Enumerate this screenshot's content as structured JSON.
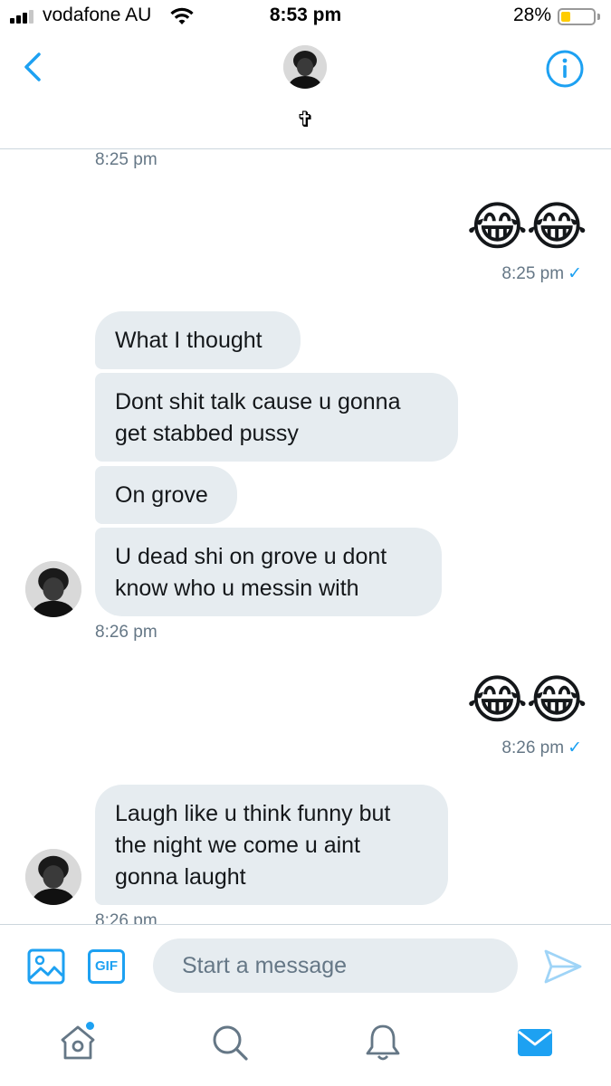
{
  "status_bar": {
    "carrier": "vodafone AU",
    "time": "8:53 pm",
    "battery_percent": "28%",
    "battery_level": 0.28,
    "signal_bars": 3
  },
  "header": {
    "contact_name": "✞",
    "back_icon": "chevron-left-icon",
    "info_icon": "info-icon"
  },
  "messages": [
    {
      "type": "timestamp",
      "side": "received",
      "text": "8:25 pm"
    },
    {
      "type": "emoji",
      "side": "sent",
      "text": "😂😂"
    },
    {
      "type": "timestamp",
      "side": "sent",
      "text": "8:25 pm",
      "read_receipt": "✓"
    },
    {
      "type": "bubble",
      "side": "received",
      "lines": [
        "What I thought"
      ]
    },
    {
      "type": "bubble",
      "side": "received",
      "lines": [
        "Dont shit talk cause u gonna",
        "get stabbed pussy"
      ]
    },
    {
      "type": "bubble",
      "side": "received",
      "lines": [
        "On grove"
      ]
    },
    {
      "type": "bubble",
      "side": "received",
      "lines": [
        "U dead shi on grove u dont",
        "know who u messin with"
      ]
    },
    {
      "type": "timestamp",
      "side": "received",
      "text": "8:26 pm"
    },
    {
      "type": "emoji",
      "side": "sent",
      "text": "😂😂"
    },
    {
      "type": "timestamp",
      "side": "sent",
      "text": "8:26 pm",
      "read_receipt": "✓"
    },
    {
      "type": "bubble",
      "side": "received",
      "lines": [
        "Laugh like u think funny but",
        "the night we come u aint",
        "gonna laught"
      ]
    },
    {
      "type": "timestamp",
      "side": "received",
      "text": "8:26 pm"
    }
  ],
  "composer": {
    "placeholder": "Start a message",
    "gif_label": "GIF",
    "media_icon": "image-icon",
    "send_icon": "send-icon"
  },
  "tab_bar": {
    "items": [
      "home-icon",
      "search-icon",
      "bell-icon",
      "mail-icon"
    ],
    "active": "mail-icon",
    "accent_color": "#1da1f2"
  },
  "colors": {
    "accent": "#1da1f2",
    "bubble_received": "#e6ecf0",
    "timestamp": "#657786"
  }
}
